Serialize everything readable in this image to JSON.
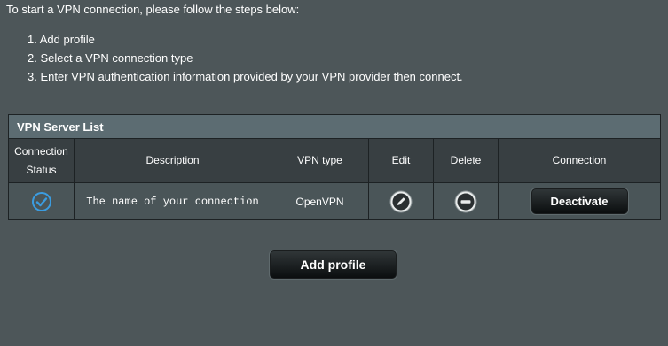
{
  "intro": "To start a VPN connection, please follow the steps below:",
  "steps": [
    "1. Add profile",
    "2. Select a VPN connection type",
    "3. Enter VPN authentication information provided by your VPN provider then connect."
  ],
  "table": {
    "title": "VPN Server List",
    "headers": {
      "status_line1": "Connection",
      "status_line2": "Status",
      "description": "Description",
      "vpn_type": "VPN type",
      "edit": "Edit",
      "delete": "Delete",
      "connection": "Connection"
    },
    "rows": [
      {
        "status_icon": "check-circle-icon",
        "description": "The name of your connection",
        "vpn_type": "OpenVPN",
        "edit_icon": "pencil-icon",
        "delete_icon": "minus-circle-icon",
        "connection_label": "Deactivate"
      }
    ]
  },
  "add_profile_label": "Add profile",
  "colors": {
    "background": "#4d5659",
    "title_bar": "#5c6c72",
    "header_row": "#383f42",
    "check_blue": "#3b9ce0"
  }
}
